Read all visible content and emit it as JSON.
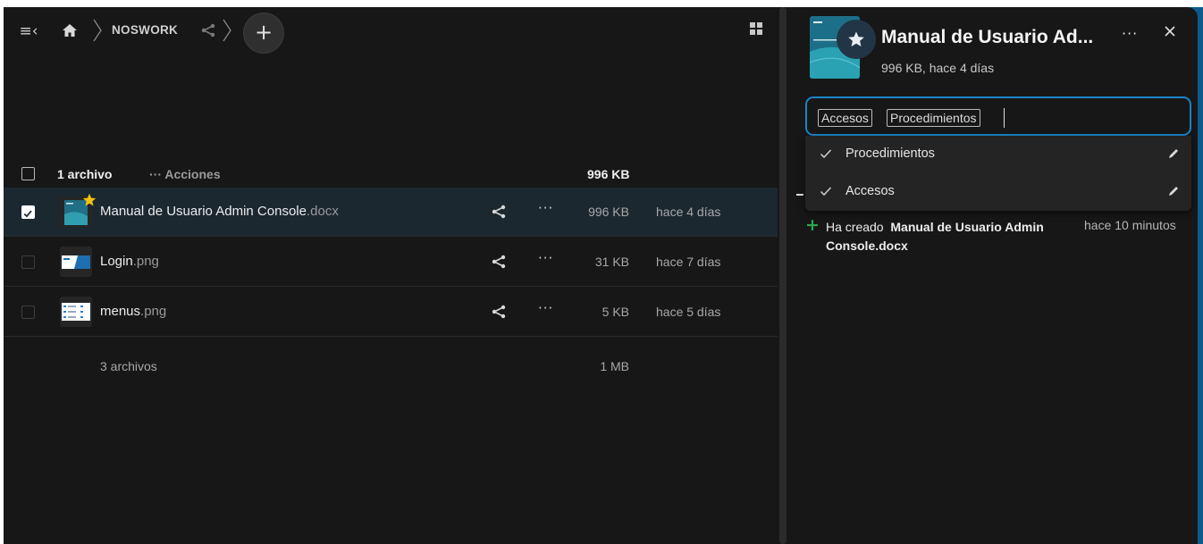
{
  "breadcrumb": {
    "folder": "NOSWORK"
  },
  "list_header": {
    "selected_count": "1 archivo",
    "actions": "··· Acciones",
    "selected_size": "996 KB"
  },
  "files": [
    {
      "name": "Manual de Usuario Admin Console",
      "ext": ".docx",
      "size": "996 KB",
      "date": "hace 4 días",
      "selected": true,
      "favorite": true
    },
    {
      "name": "Login",
      "ext": ".png",
      "size": "31 KB",
      "date": "hace 7 días",
      "selected": false,
      "favorite": false
    },
    {
      "name": "menus",
      "ext": ".png",
      "size": "5 KB",
      "date": "hace 5 días",
      "selected": false,
      "favorite": false
    }
  ],
  "summary": {
    "count": "3 archivos",
    "total": "1 MB"
  },
  "sidebar": {
    "title": "Manual de Usuario Ad...",
    "subtitle": "996 KB, hace 4 días",
    "tags": [
      "Accesos",
      "Procedimientos"
    ],
    "tag_options": [
      {
        "label": "Procedimientos",
        "checked": true
      },
      {
        "label": "Accesos",
        "checked": true
      }
    ],
    "activity": {
      "prefix": "Ha creado",
      "file": "Manual de Usuario Admin Console.docx",
      "when": "hace 10 minutos"
    }
  },
  "colors": {
    "accent": "#1a85c8",
    "favorite": "#f4c20d",
    "created": "#2fa84f",
    "selected_row": "#1b2830"
  }
}
